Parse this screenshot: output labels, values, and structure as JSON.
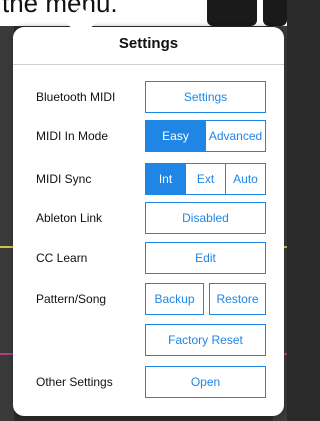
{
  "background": {
    "clipped_text": "the menu."
  },
  "popover": {
    "title": "Settings",
    "rows": {
      "bluetooth": {
        "label": "Bluetooth MIDI",
        "button": "Settings"
      },
      "midi_in_mode": {
        "label": "MIDI In Mode",
        "options": [
          "Easy",
          "Advanced"
        ],
        "selected": "Easy"
      },
      "midi_sync": {
        "label": "MIDI Sync",
        "options": [
          "Int",
          "Ext",
          "Auto"
        ],
        "selected": "Int"
      },
      "ableton_link": {
        "label": "Ableton Link",
        "button": "Disabled"
      },
      "cc_learn": {
        "label": "CC Learn",
        "button": "Edit"
      },
      "pattern_song": {
        "label": "Pattern/Song",
        "buttons": [
          "Backup",
          "Restore"
        ]
      },
      "factory_reset": {
        "button": "Factory Reset"
      },
      "other_settings": {
        "label": "Other Settings",
        "button": "Open"
      }
    }
  },
  "colors": {
    "accent": "#1f86e6",
    "popover_bg": "#ffffff",
    "backdrop": "#2a2a2a"
  }
}
